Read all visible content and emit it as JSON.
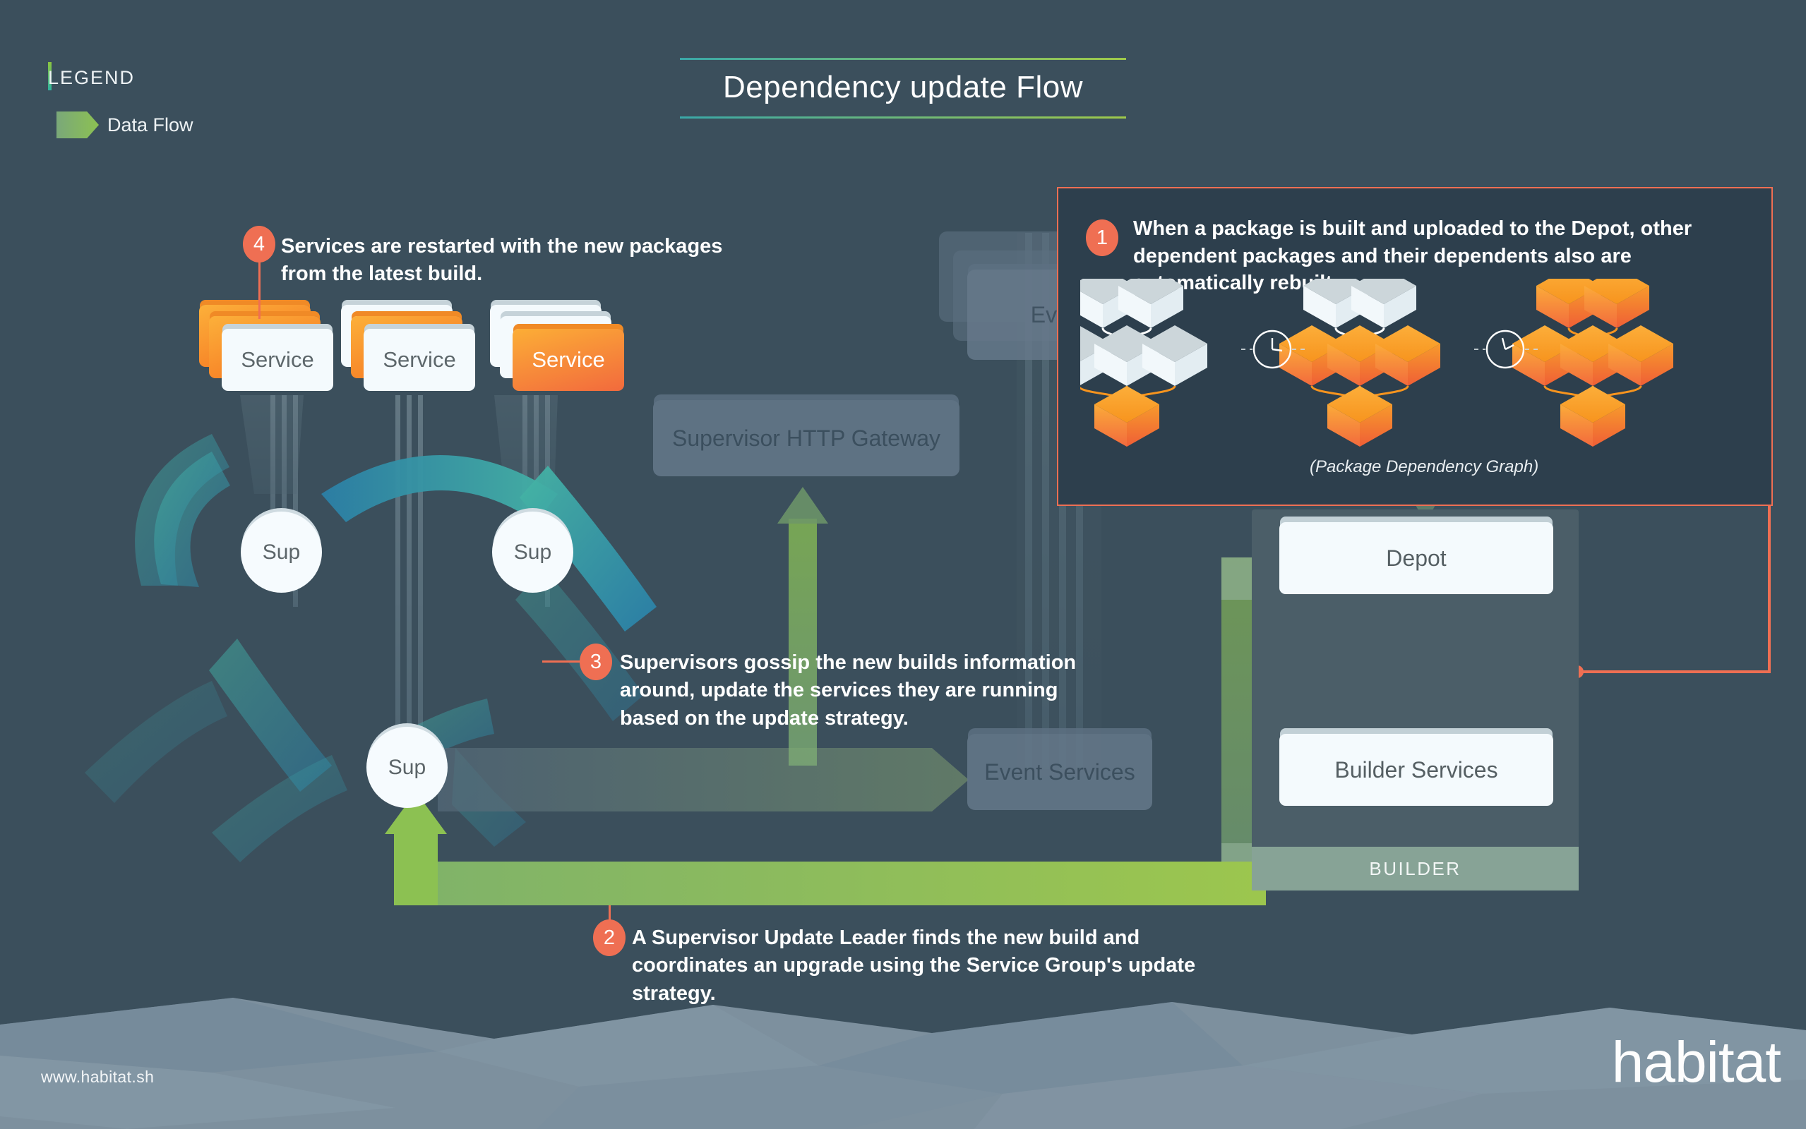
{
  "legend": {
    "title": "LEGEND",
    "items": [
      {
        "label": "Data Flow",
        "color": "#8cc152"
      }
    ]
  },
  "header": {
    "title": "Dependency update Flow"
  },
  "footer": {
    "url": "www.habitat.sh",
    "brand": "habitat"
  },
  "colors": {
    "background": "#3b4f5c",
    "accent_orange": "#ef6f53",
    "flow_green": "#8cc152",
    "gossip_teal": "#2f9fa8",
    "panel_dark": "#2d3f4d",
    "builder_panel": "#4b5e68",
    "builder_bar": "#87a396"
  },
  "steps": [
    {
      "number": "1",
      "text": "When a package is built and uploaded to the Depot, other dependent packages and their dependents also are automatically rebuilt."
    },
    {
      "number": "2",
      "text": "A Supervisor Update Leader finds the new build and coordinates an upgrade using the Service Group's update strategy."
    },
    {
      "number": "3",
      "text": "Supervisors gossip the new builds information around, update the services they are running based on the update strategy."
    },
    {
      "number": "4",
      "text": "Services are restarted with the new packages from the latest build."
    }
  ],
  "package_graph": {
    "caption": "(Package Dependency Graph)",
    "stages": [
      {
        "name": "before",
        "top_cubes": "white",
        "mid_cubes": "white",
        "bottom_cube": "orange"
      },
      {
        "name": "middle",
        "top_cubes": "white",
        "mid_cubes": "orange",
        "bottom_cube": "orange"
      },
      {
        "name": "after",
        "top_cubes": "orange",
        "mid_cubes": "orange",
        "bottom_cube": "orange"
      }
    ],
    "separator_icon": "clock-icon"
  },
  "services": [
    {
      "label": "Service",
      "front": "white",
      "stack": [
        "orange",
        "orange"
      ]
    },
    {
      "label": "Service",
      "front": "white",
      "stack": [
        "white",
        "orange"
      ]
    },
    {
      "label": "Service",
      "front": "orange",
      "stack": [
        "white",
        "white"
      ]
    }
  ],
  "supervisors": [
    {
      "label": "Sup"
    },
    {
      "label": "Sup"
    },
    {
      "label": "Sup"
    }
  ],
  "nodes": {
    "gateway": "Supervisor HTTP Gateway",
    "event_listeners": "Event Listeners",
    "event_services": "Event Services",
    "depot": "Depot",
    "builder_services": "Builder Services",
    "builder": "BUILDER"
  }
}
